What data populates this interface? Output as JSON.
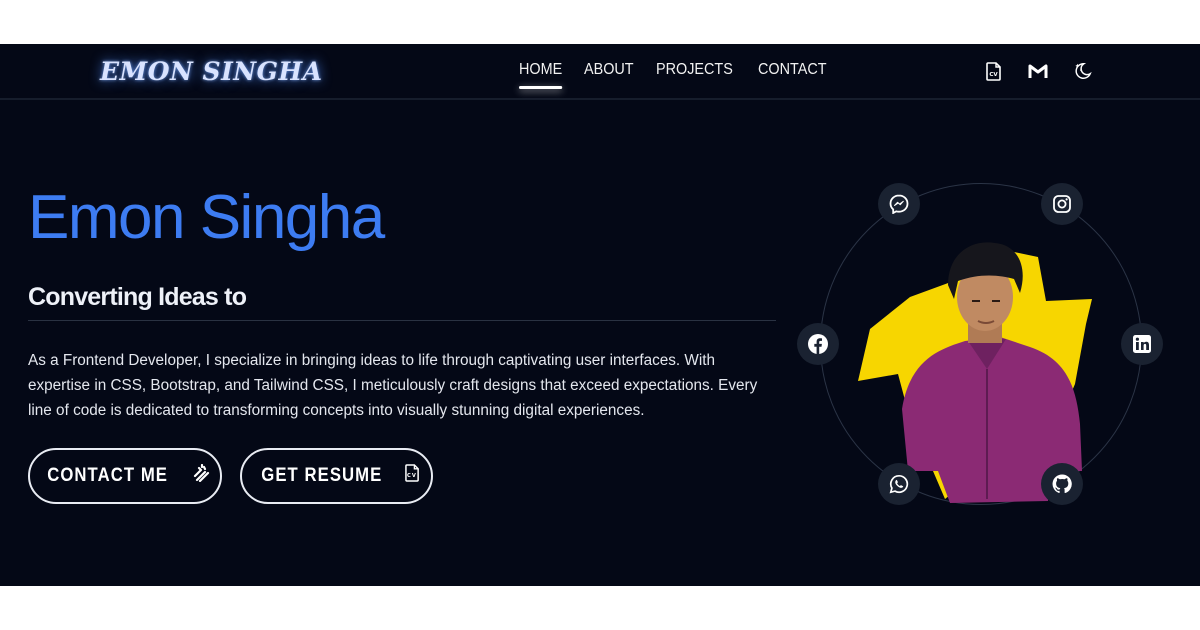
{
  "nav": {
    "logo": "EMON SINGHA",
    "links": [
      {
        "label": "HOME",
        "active": true
      },
      {
        "label": "ABOUT",
        "active": false
      },
      {
        "label": "PROJECTS",
        "active": false
      },
      {
        "label": "CONTACT",
        "active": false
      }
    ],
    "icons": [
      "cv-file-icon",
      "gmail-icon",
      "moon-stars-icon"
    ]
  },
  "hero": {
    "name": "Emon Singha",
    "subtitle": "Converting Ideas to",
    "description": "As a Frontend Developer, I specialize in bringing ideas to life through captivating user interfaces. With expertise in CSS, Bootstrap, and Tailwind CSS, I meticulously craft designs that exceed expectations. Every line of code is dedicated to transforming concepts into visually stunning digital experiences.",
    "buttons": {
      "contact": "CONTACT ME",
      "resume": "GET RESUME"
    }
  },
  "socials": [
    "messenger-icon",
    "instagram-icon",
    "facebook-icon",
    "linkedin-icon",
    "whatsapp-icon",
    "github-icon"
  ],
  "colors": {
    "background": "#040816",
    "accent": "#3d7cf2",
    "highlight": "#f7d600",
    "shirt": "#8b2a74"
  }
}
